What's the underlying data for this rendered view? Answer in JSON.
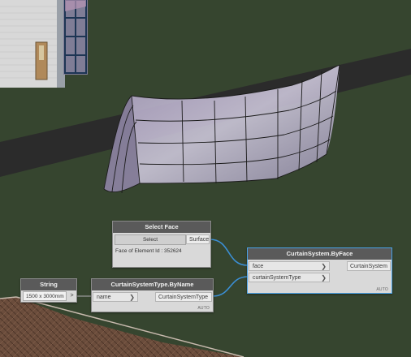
{
  "nodes": {
    "select_face": {
      "title": "Select Face",
      "button_label": "Select",
      "output_port": "Surface",
      "info_text": "Face of Element Id : 352624"
    },
    "curtain_system_by_face": {
      "title": "CurtainSystem.ByFace",
      "inputs": [
        "face",
        "curtainSystemType"
      ],
      "output_port": "CurtainSystem",
      "lacing": "AUTO"
    },
    "string": {
      "title": "String",
      "value": "1500 x 3000mm",
      "output_port": ">"
    },
    "curtain_system_type_by_name": {
      "title": "CurtainSystemType.ByName",
      "inputs": [
        "name"
      ],
      "output_port": "CurtainSystemType",
      "lacing": "AUTO"
    }
  },
  "colors": {
    "background": "#36452f",
    "wire": "#3b8fd6",
    "node_header": "#5a5a5a",
    "node_body": "#d9d9d9",
    "selection": "#4aa3e8"
  }
}
